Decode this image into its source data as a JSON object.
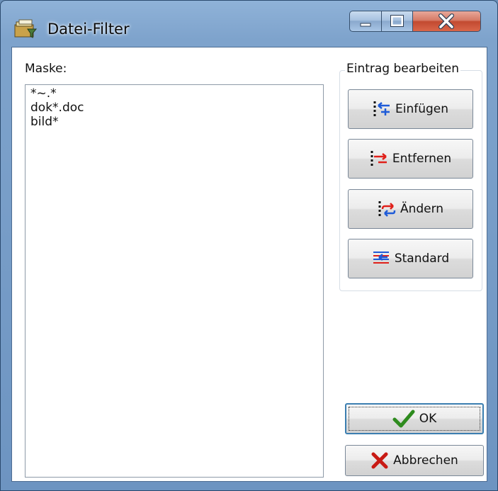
{
  "window": {
    "title": "Datei-Filter",
    "icon": "filter-folder-icon",
    "controls": {
      "minimize": "minimize-icon",
      "maximize": "maximize-icon",
      "close": "close-icon"
    }
  },
  "mask": {
    "label": "Maske:",
    "items": [
      "*~.*",
      "dok*.doc",
      "bild*"
    ]
  },
  "edit_group": {
    "label": "Eintrag bearbeiten",
    "insert_label": "Einfügen",
    "remove_label": "Entfernen",
    "change_label": "Ändern",
    "default_label": "Standard"
  },
  "dialog": {
    "ok_label": "OK",
    "cancel_label": "Abbrechen"
  },
  "colors": {
    "accent_blue": "#1e5bd8",
    "accent_red": "#e0201a",
    "ok_green": "#2e8b1e"
  }
}
